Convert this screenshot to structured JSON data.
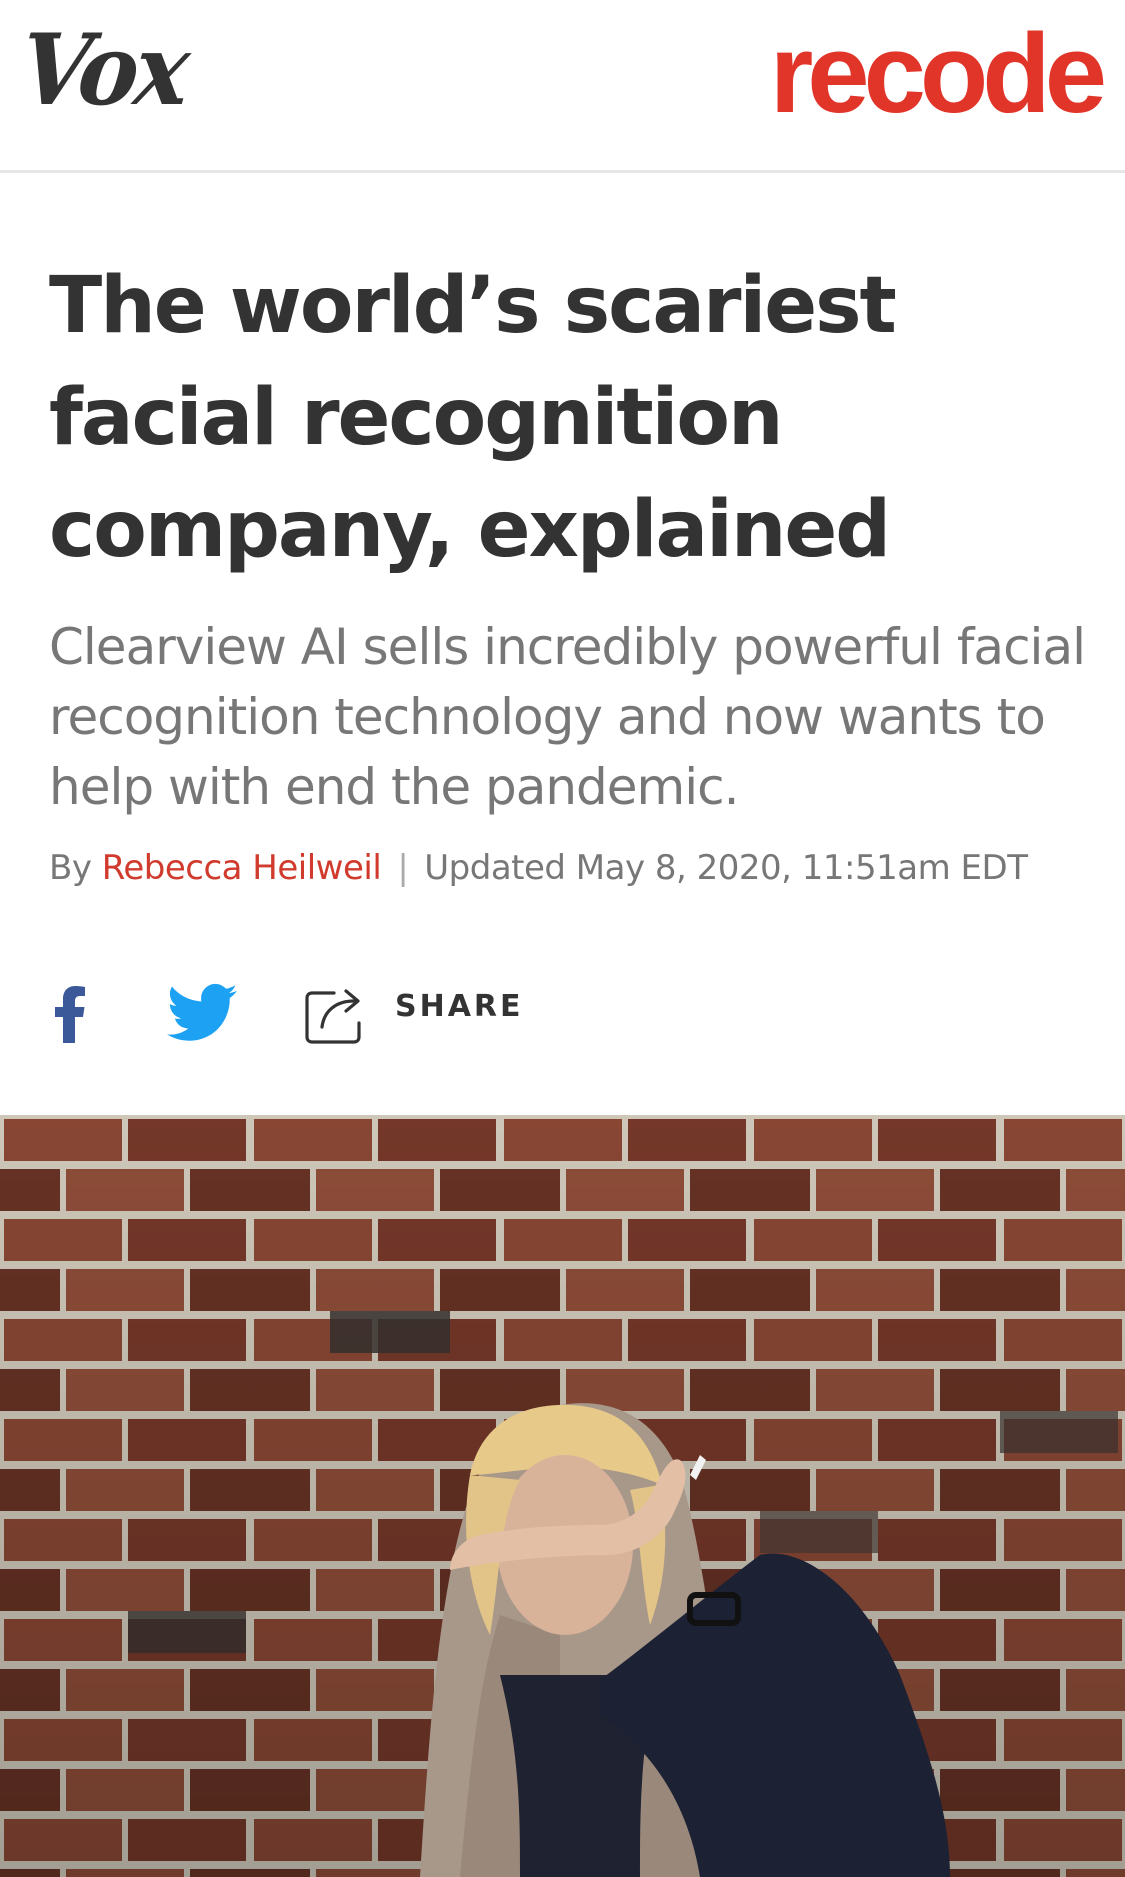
{
  "header": {
    "vox_logo": "Vox",
    "recode_logo": "recode"
  },
  "article": {
    "headline": "The world’s scariest facial recognition company, explained",
    "dek": "Clearview AI sells incredibly powerful facial recognition technology and now wants to help with end the pandemic.",
    "byline_prefix": "By",
    "author": "Rebecca Heilweil",
    "separator": "|",
    "updated": "Updated May 8, 2020, 11:51am EDT"
  },
  "share": {
    "facebook_icon": "facebook-icon",
    "twitter_icon": "twitter-icon",
    "share_icon": "share-icon",
    "share_label": "SHARE"
  },
  "colors": {
    "recode_red": "#e2352a",
    "author_red": "#d03b2d",
    "facebook_blue": "#3b5998",
    "twitter_blue": "#1da1f2",
    "headline_gray": "#333333",
    "dek_gray": "#777777"
  }
}
